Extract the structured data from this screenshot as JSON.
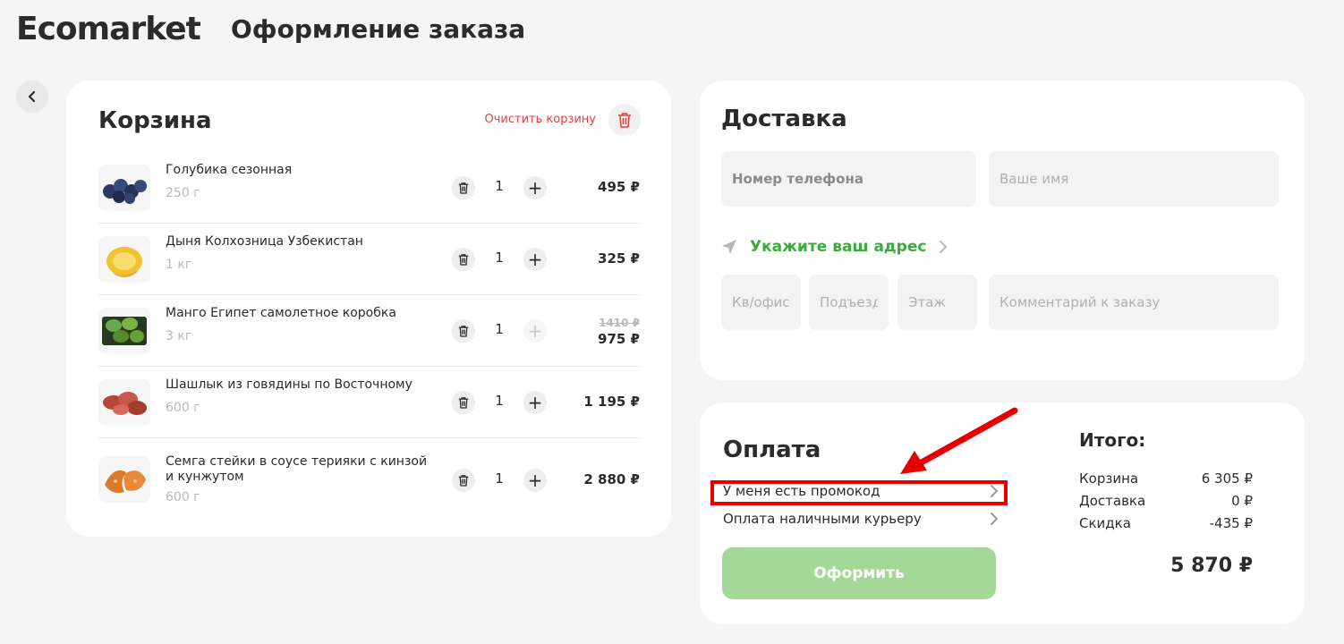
{
  "header": {
    "logo": "Ecomarket",
    "title": "Оформление заказа"
  },
  "cart": {
    "title": "Корзина",
    "clear_label": "Очистить корзину",
    "items": [
      {
        "name": "Голубика сезонная",
        "weight": "250 г",
        "qty": "1",
        "price": "495 ₽",
        "old_price": "",
        "icon": "blueberry-icon",
        "plus_enabled": true
      },
      {
        "name": "Дыня Колхозница Узбекистан",
        "weight": "1 кг",
        "qty": "1",
        "price": "325 ₽",
        "old_price": "",
        "icon": "melon-icon",
        "plus_enabled": true
      },
      {
        "name": "Манго Египет самолетное коробка",
        "weight": "3 кг",
        "qty": "1",
        "price": "975 ₽",
        "old_price": "1410 ₽",
        "icon": "mango-icon",
        "plus_enabled": false
      },
      {
        "name": "Шашлык из говядины по Восточному",
        "weight": "600 г",
        "qty": "1",
        "price": "1 195 ₽",
        "old_price": "",
        "icon": "meat-icon",
        "plus_enabled": true
      },
      {
        "name": "Семга стейки в соусе терияки с кинзой и кунжутом",
        "weight": "600 г",
        "qty": "1",
        "price": "2 880 ₽",
        "old_price": "",
        "icon": "salmon-icon",
        "plus_enabled": true
      }
    ]
  },
  "delivery": {
    "title": "Доставка",
    "phone_placeholder": "Номер телефона",
    "name_placeholder": "Ваше имя",
    "address_label": "Укажите ваш адрес",
    "apartment_placeholder": "Кв/офис",
    "entrance_placeholder": "Подъезд",
    "floor_placeholder": "Этаж",
    "comment_placeholder": "Комментарий к заказу"
  },
  "payment": {
    "title": "Оплата",
    "promo_label": "У меня есть промокод",
    "method_label": "Оплата наличными курьеру",
    "submit_label": "Оформить"
  },
  "totals": {
    "title": "Итого:",
    "rows": [
      {
        "label": "Корзина",
        "value": "6 305 ₽"
      },
      {
        "label": "Доставка",
        "value": "0 ₽"
      },
      {
        "label": "Скидка",
        "value": "-435 ₽"
      }
    ],
    "grand_total": "5 870 ₽"
  },
  "colors": {
    "accent_green": "#3cab3c",
    "button_green": "#a3d897",
    "danger_red": "#e0413f",
    "highlight_red": "#e40000"
  }
}
